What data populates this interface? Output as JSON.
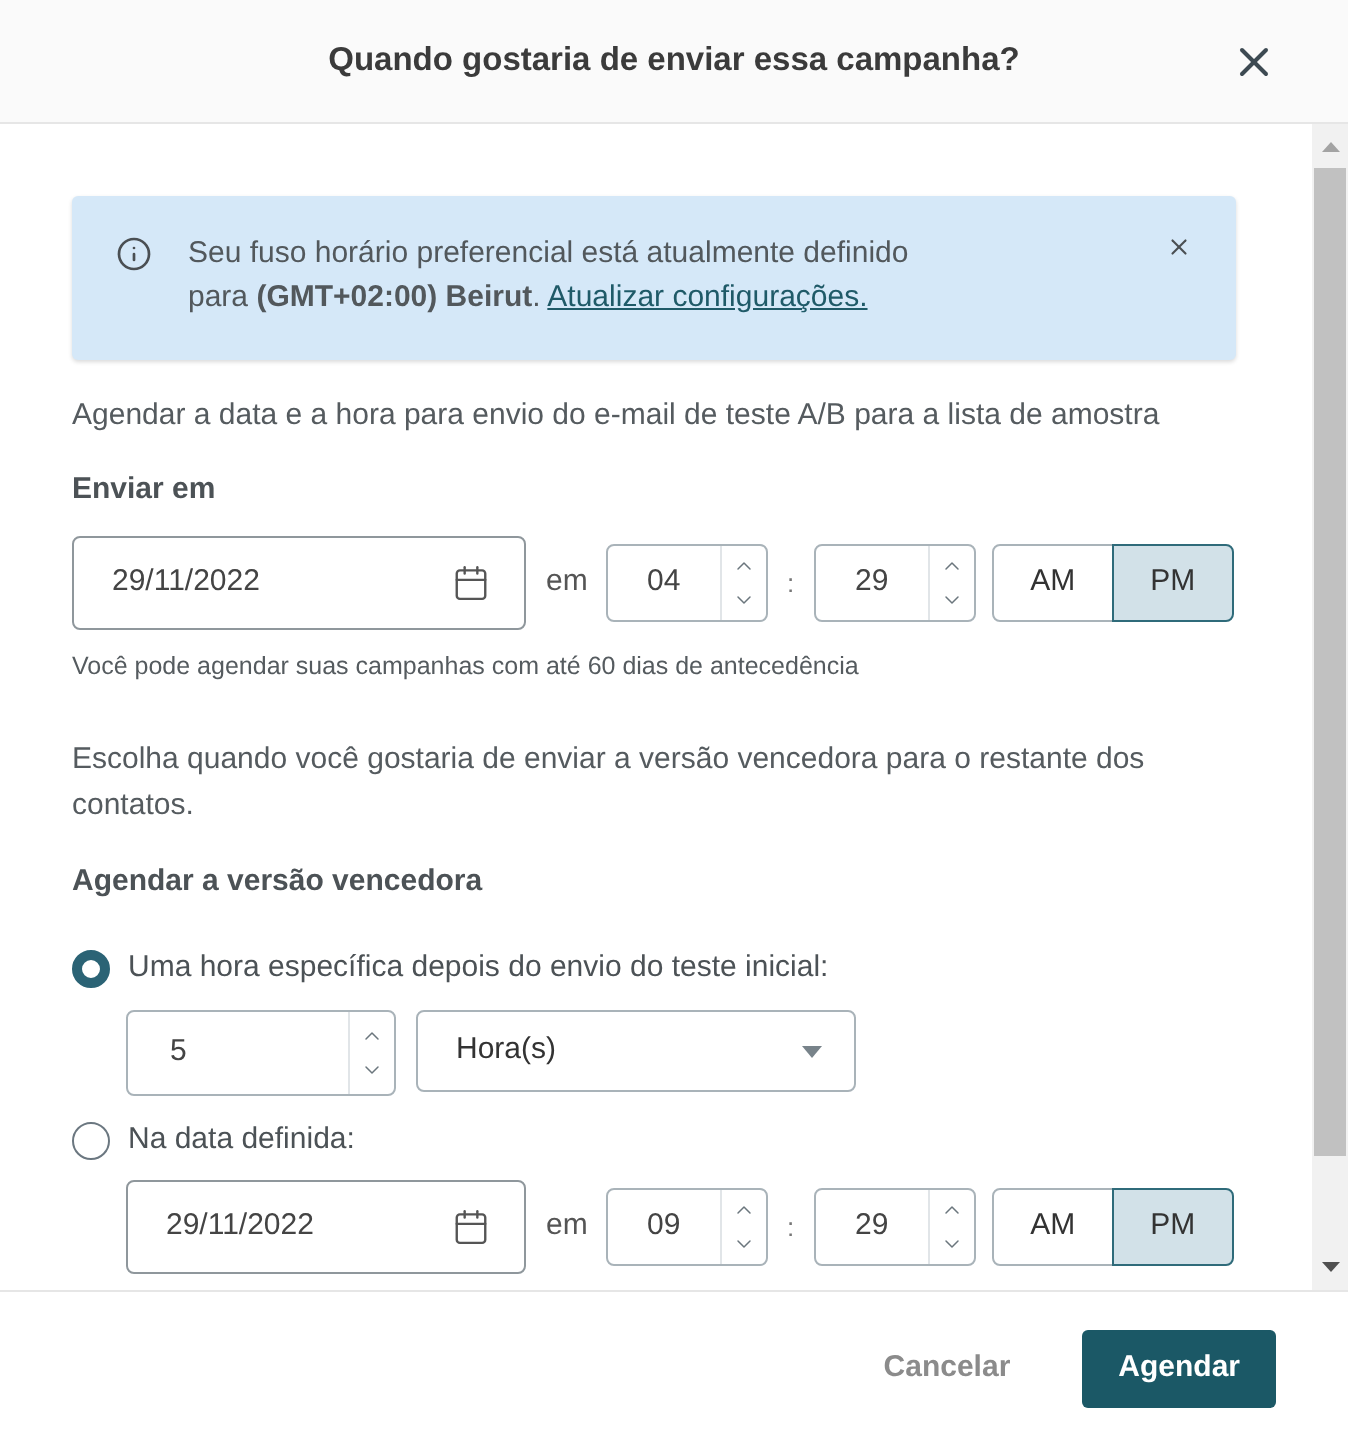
{
  "dialog": {
    "title": "Quando gostaria de enviar essa campanha?"
  },
  "alert": {
    "text": "Seu fuso horário preferencial está atualmente definido para **(GMT+02:00) Beirut**.",
    "link": "Atualizar configurações."
  },
  "schedule": {
    "description": "Agendar a data e a hora para envio do e-mail de teste A/B para a lista de amostra",
    "label": "Enviar em",
    "date": "29/11/2022",
    "connector": "em",
    "hour": "04",
    "separator": ":",
    "minute": "29",
    "periods": [
      {
        "label": "AM",
        "selected": false
      },
      {
        "label": "PM",
        "selected": true
      }
    ],
    "hint": "Você pode agendar suas campanhas com até 60 dias de antecedência"
  },
  "winner": {
    "description": "Escolha quando você gostaria de enviar a versão vencedora para o restante dos contatos.",
    "label": "Agendar a versão vencedora",
    "options": [
      {
        "kind": "delay",
        "label": "Uma hora específica depois do envio do teste inicial:",
        "selected": true,
        "amount": "5",
        "unit": "Hora(s)"
      },
      {
        "kind": "date",
        "label": "Na data definida:",
        "selected": false,
        "date": "29/11/2022",
        "connector": "em",
        "hour": "09",
        "separator": ":",
        "minute": "29",
        "periods": [
          {
            "label": "AM",
            "selected": false
          },
          {
            "label": "PM",
            "selected": true
          }
        ]
      }
    ]
  },
  "footer": {
    "buttons": [
      {
        "kind": "secondary",
        "label": "Cancelar"
      },
      {
        "kind": "primary",
        "label": "Agendar"
      }
    ]
  }
}
